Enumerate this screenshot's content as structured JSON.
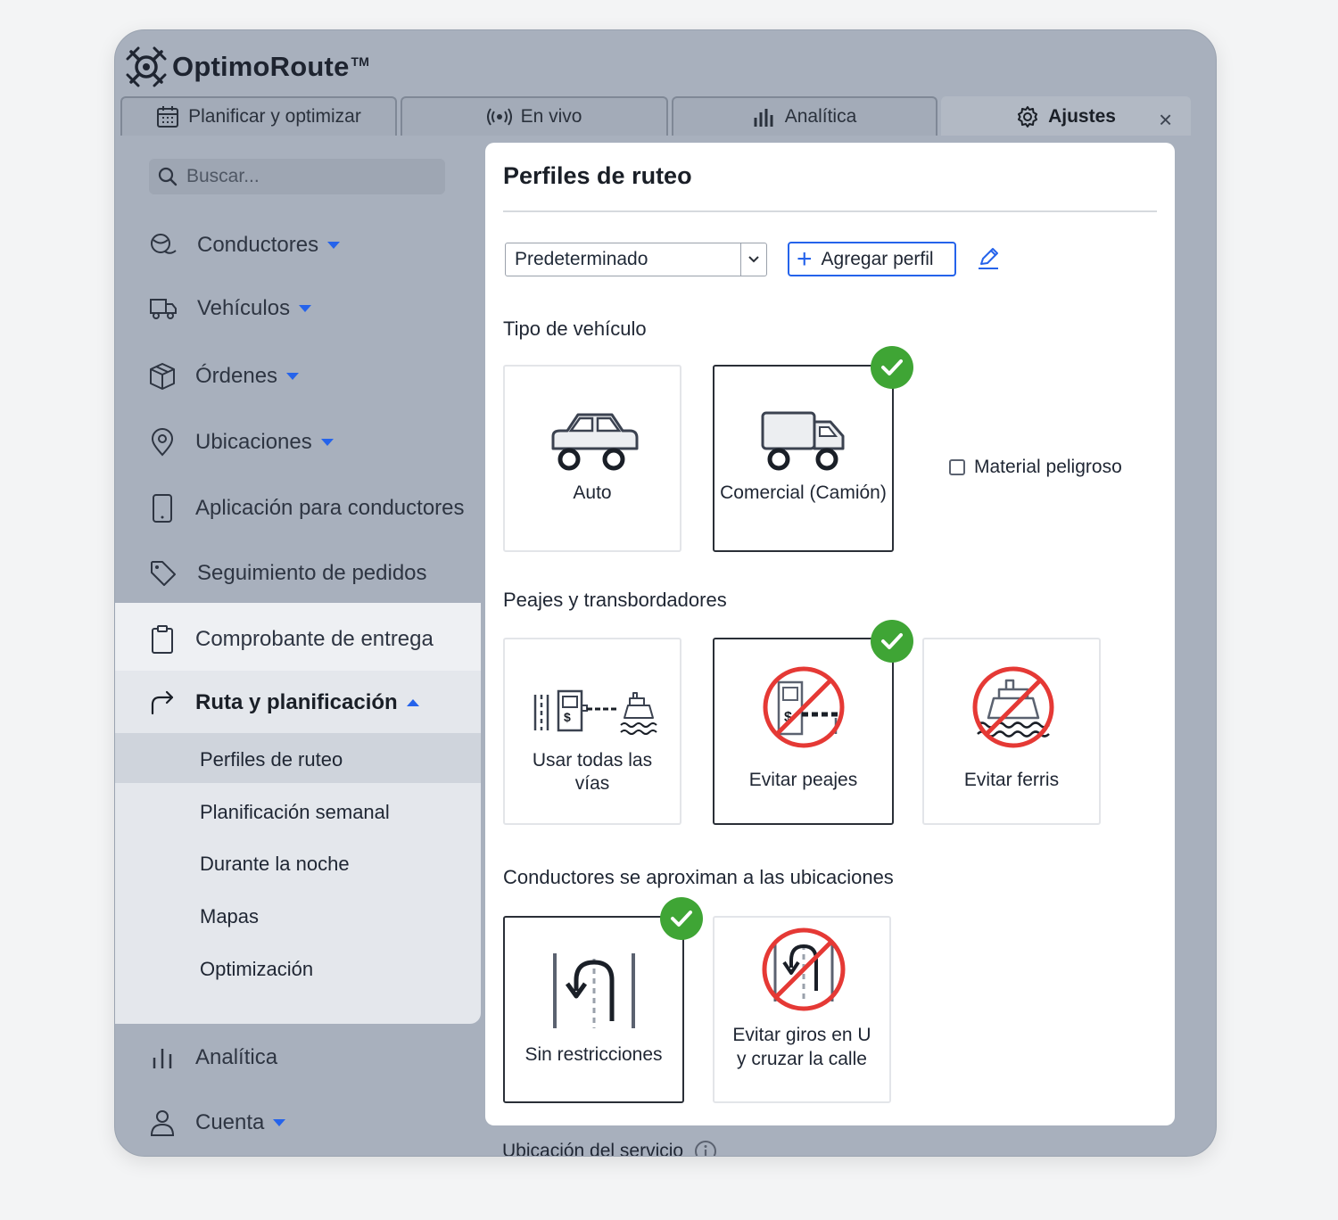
{
  "app": {
    "name": "OptimoRoute",
    "tm": "TM"
  },
  "tabs": [
    {
      "label": "Planificar y optimizar",
      "icon": "calendar-icon"
    },
    {
      "label": "En vivo",
      "icon": "live-broadcast-icon"
    },
    {
      "label": "Analítica",
      "icon": "bar-chart-icon"
    },
    {
      "label": "Ajustes",
      "icon": "gear-icon",
      "active": true
    }
  ],
  "close_label": "×",
  "sidebar": {
    "search_placeholder": "Buscar...",
    "items": [
      {
        "label": "Conductores",
        "icon": "drivers-icon"
      },
      {
        "label": "Vehículos",
        "icon": "truck-icon"
      },
      {
        "label": "Órdenes",
        "icon": "box-icon"
      },
      {
        "label": "Ubicaciones",
        "icon": "location-pin-icon"
      },
      {
        "label": "Aplicación para conductores",
        "icon": "phone-icon"
      },
      {
        "label": "Seguimiento de pedidos",
        "icon": "tag-icon"
      },
      {
        "label": "Comprobante de entrega",
        "icon": "clipboard-icon"
      },
      {
        "label": "Ruta y planificación",
        "icon": "route-arrow-icon",
        "expanded": true
      }
    ],
    "sub_items": [
      {
        "label": "Perfiles de ruteo",
        "active": true
      },
      {
        "label": "Planificación semanal"
      },
      {
        "label": "Durante la noche"
      },
      {
        "label": "Mapas"
      },
      {
        "label": "Optimización"
      }
    ],
    "bottom_items": [
      {
        "label": "Analítica",
        "icon": "analytics-icon"
      },
      {
        "label": "Cuenta",
        "icon": "user-icon"
      }
    ]
  },
  "main": {
    "title": "Perfiles de ruteo",
    "profile_select": "Predeterminado",
    "add_profile_label": "Agregar perfil",
    "vehicle": {
      "heading": "Tipo de vehículo",
      "options": [
        {
          "label": "Auto",
          "selected": false
        },
        {
          "label": "Comercial (Camión)",
          "selected": true
        }
      ],
      "hazmat_label": "Material peligroso",
      "hazmat_checked": false
    },
    "tolls": {
      "heading": "Peajes y transbordadores",
      "options": [
        {
          "label1": "Usar todas las",
          "label2": "vías",
          "selected": false
        },
        {
          "label": "Evitar peajes",
          "selected": true
        },
        {
          "label": "Evitar ferris",
          "selected": false
        }
      ]
    },
    "approach": {
      "heading": "Conductores se aproximan a las ubicaciones",
      "options": [
        {
          "label": "Sin restricciones",
          "selected": true
        },
        {
          "label1": "Evitar giros en U",
          "label2": "y cruzar la calle",
          "selected": false
        }
      ]
    },
    "service_location_label": "Ubicación del servicio"
  },
  "colors": {
    "accent": "#2563eb",
    "check": "#3fa535",
    "forbidden": "#e53935",
    "frame": "#a8b0bd"
  }
}
